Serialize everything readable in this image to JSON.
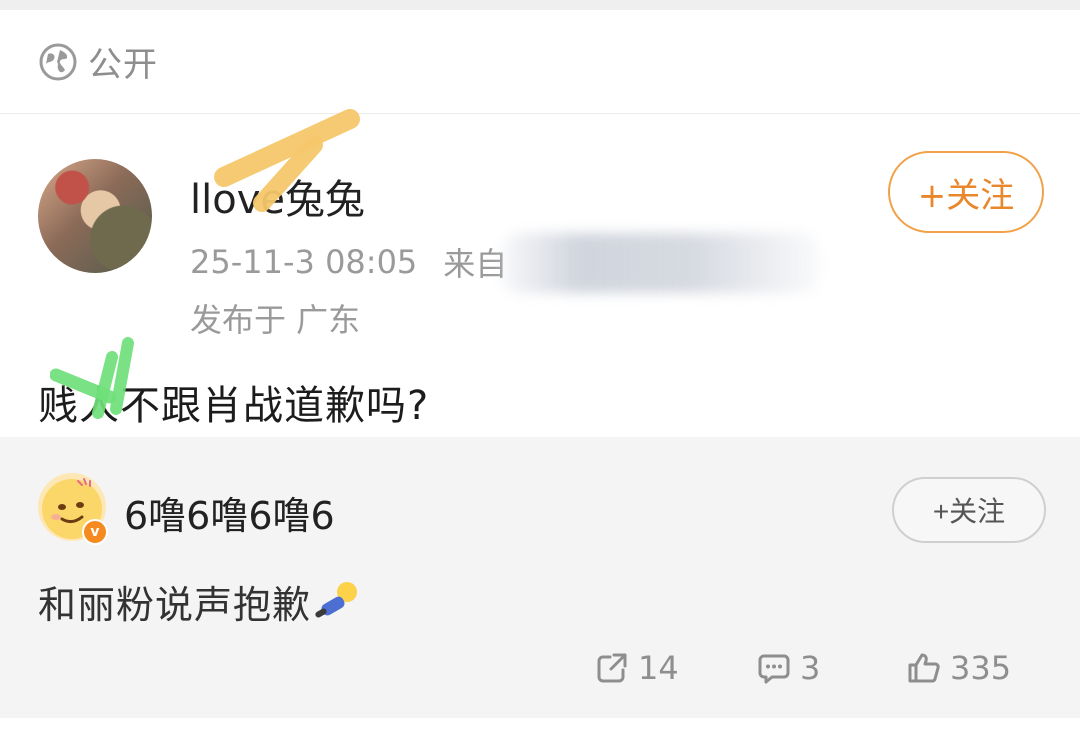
{
  "visibility": {
    "label": "公开",
    "icon": "globe-icon"
  },
  "post": {
    "username": "llove兔兔",
    "timestamp": "25-11-3 08:05",
    "source_prefix": "来自",
    "location": "发布于 广东",
    "content": "贱人不跟肖战道歉吗?",
    "follow_label": "+关注"
  },
  "repost": {
    "username": "6噜6噜6噜6",
    "follow_label": "+关注",
    "content": "和丽粉说声抱歉",
    "badge": "v"
  },
  "actions": {
    "repost_count": "14",
    "comment_count": "3",
    "like_count": "335"
  },
  "colors": {
    "accent_orange": "#e8872b",
    "muted_text": "#9a9a9a",
    "repost_bg": "#f4f4f4"
  }
}
